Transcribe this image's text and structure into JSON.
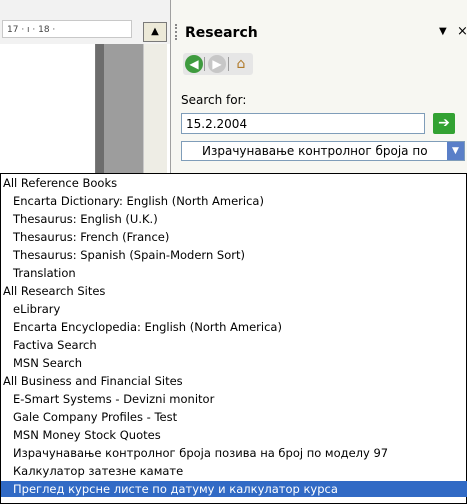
{
  "ruler": {
    "text": "17 · ı · 18 ·"
  },
  "pane": {
    "title": "Research",
    "menu_glyph": "▼",
    "close_glyph": "×",
    "search_label": "Search for:",
    "search_value": "15.2.2004",
    "selected_source": "Израчунавање контролног броја по"
  },
  "dropdown": {
    "items": [
      {
        "label": "All Reference Books",
        "kind": "cat"
      },
      {
        "label": "Encarta Dictionary: English (North America)",
        "kind": "sub"
      },
      {
        "label": "Thesaurus: English (U.K.)",
        "kind": "sub"
      },
      {
        "label": "Thesaurus: French (France)",
        "kind": "sub"
      },
      {
        "label": "Thesaurus: Spanish (Spain-Modern Sort)",
        "kind": "sub"
      },
      {
        "label": "Translation",
        "kind": "sub"
      },
      {
        "label": "All Research Sites",
        "kind": "cat"
      },
      {
        "label": "eLibrary",
        "kind": "sub"
      },
      {
        "label": "Encarta Encyclopedia: English (North America)",
        "kind": "sub"
      },
      {
        "label": "Factiva Search",
        "kind": "sub"
      },
      {
        "label": "MSN Search",
        "kind": "sub"
      },
      {
        "label": "All Business and Financial Sites",
        "kind": "cat"
      },
      {
        "label": "E-Smart Systems - Devizni monitor",
        "kind": "sub"
      },
      {
        "label": "Gale Company Profiles - Test",
        "kind": "sub"
      },
      {
        "label": "MSN Money Stock Quotes",
        "kind": "sub"
      },
      {
        "label": "Израчунавање контролног броја позива на број по моделу 97",
        "kind": "sub"
      },
      {
        "label": "Калкулатор затезне камате",
        "kind": "sub"
      },
      {
        "label": "Преглед курсне листе по датуму и калкулатор курса",
        "kind": "sub",
        "selected": true
      }
    ]
  }
}
